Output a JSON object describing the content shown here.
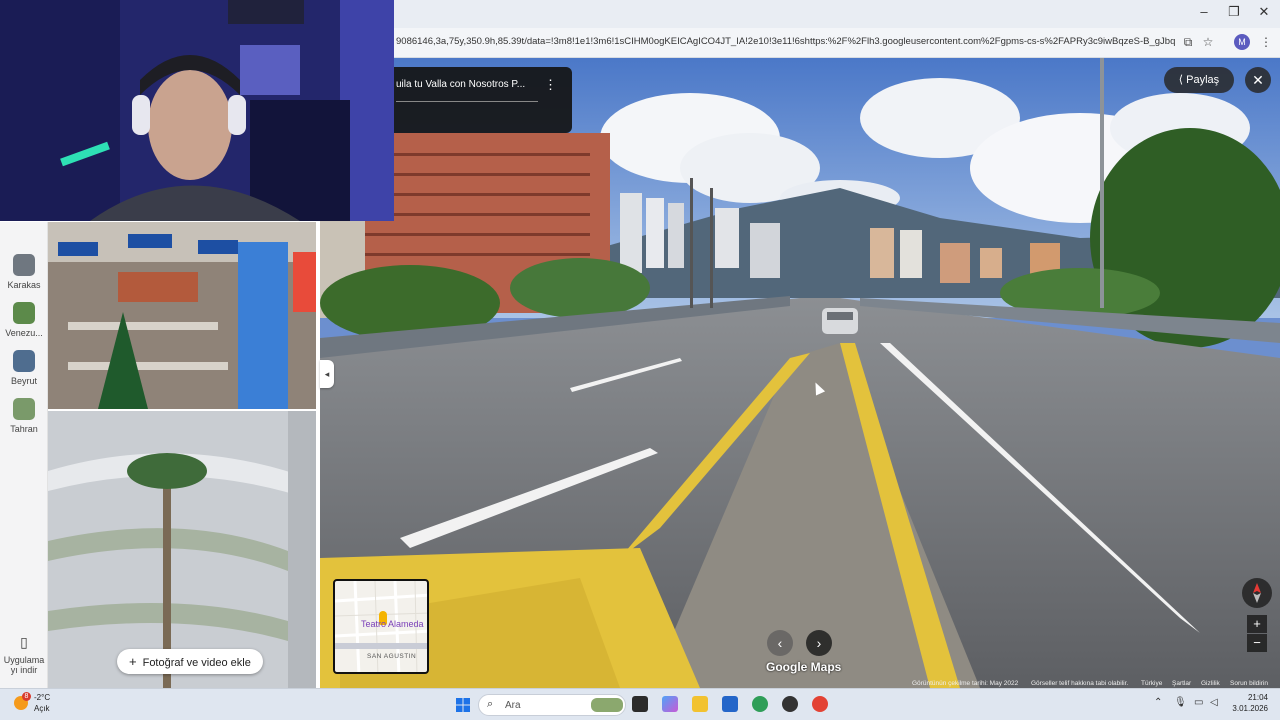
{
  "window": {
    "minimize_label": "–",
    "restore_label": "❐",
    "close_label": "✕"
  },
  "address_bar": {
    "url": "9086146,3a,75y,350.9h,85.39t/data=!3m8!1e1!3m6!1sCIHM0ogKEICAgICO4JT_IA!2e10!3e11!6shttps:%2F%2Flh3.googleusercontent.com%2Fgpms-cs-s%2FAPRy3c9iwBqzeS-B_gJbqRqmPYc..."
  },
  "profile": {
    "initial": "M"
  },
  "left_rail": {
    "items": [
      {
        "label": "Karakas",
        "thumb_color": "#6f7780"
      },
      {
        "label": "Venezu...",
        "thumb_color": "#5c8a4a"
      },
      {
        "label": "Beyrut",
        "thumb_color": "#4f6d8f"
      },
      {
        "label": "Tahran",
        "thumb_color": "#7a9a6a"
      }
    ],
    "download_label": "Uygulama yı indir"
  },
  "photos": {
    "add_button_label": "Fotoğraf ve video ekle"
  },
  "street_view": {
    "share_label": "Paylaş",
    "title_card_text": "uila tu Valla con Nosotros P...",
    "minimap": {
      "place_label": "Teatro Alameda",
      "area_label": "SAN AGUSTIN"
    },
    "prev_label": "‹",
    "next_label": "›",
    "watermark": "Google Maps",
    "footer": {
      "capture_date": "Görüntünün çekilme tarihi: May 2022",
      "copyright": "Görseller telif hakkına tabi olabilir.",
      "country": "Türkiye",
      "terms": "Şartlar",
      "privacy": "Gizlilik",
      "report": "Sorun bildirin"
    }
  },
  "taskbar": {
    "weather": {
      "badge": "8",
      "temp": "-2°C",
      "condition": "Açık"
    },
    "search_placeholder": "Ara",
    "clock": {
      "time": "21:04",
      "date": "3.01.2026"
    }
  }
}
